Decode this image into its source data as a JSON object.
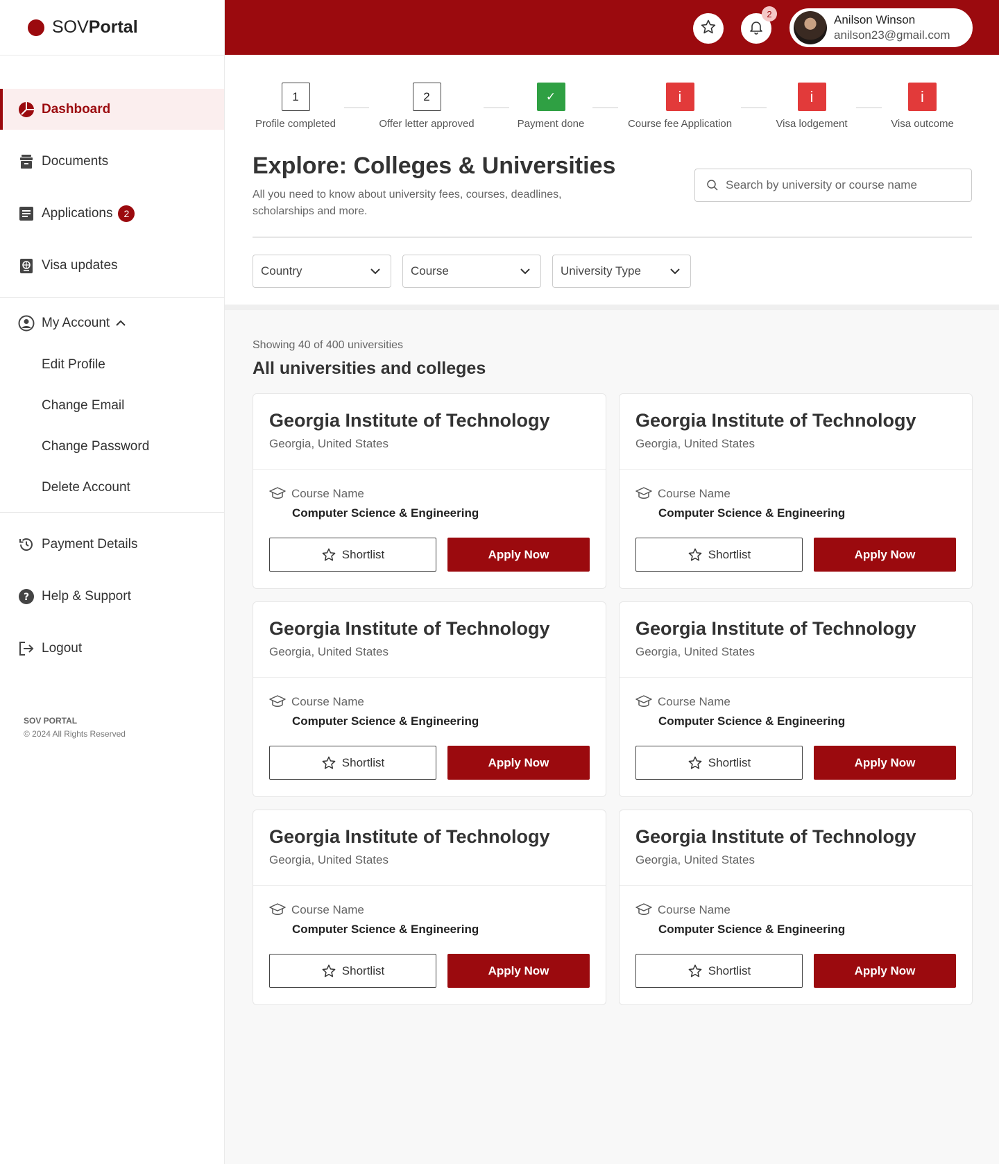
{
  "brand": {
    "prefix": "SOV",
    "suffix": "Portal",
    "color": "#9b0a0e"
  },
  "sidebar": {
    "main_items": [
      {
        "label": "Dashboard",
        "icon": "pie-chart-icon",
        "active": true
      },
      {
        "label": "Documents",
        "icon": "archive-icon"
      },
      {
        "label": "Applications",
        "icon": "list-icon",
        "badge": "2"
      },
      {
        "label": "Visa updates",
        "icon": "passport-icon"
      }
    ],
    "account": {
      "label": "My Account",
      "icon": "user-circle-icon",
      "sub_items": [
        "Edit Profile",
        "Change Email",
        "Change Password",
        "Delete Account"
      ]
    },
    "bottom_items": [
      {
        "label": "Payment Details",
        "icon": "history-icon"
      },
      {
        "label": "Help & Support",
        "icon": "help-icon"
      },
      {
        "label": "Logout",
        "icon": "logout-icon"
      }
    ],
    "footer": {
      "brand": "SOV PORTAL",
      "copyright": "© 2024 All Rights Reserved"
    }
  },
  "topbar": {
    "notifications_count": "2",
    "user": {
      "name": "Anilson Winson",
      "email": "anilson23@gmail.com"
    }
  },
  "steps": [
    {
      "label": "Profile completed",
      "value": "1",
      "status": "pending"
    },
    {
      "label": "Offer letter approved",
      "value": "2",
      "status": "pending"
    },
    {
      "label": "Payment done",
      "value": "✓",
      "status": "done"
    },
    {
      "label": "Course fee Application",
      "value": "i",
      "status": "alert"
    },
    {
      "label": "Visa lodgement",
      "value": "i",
      "status": "alert"
    },
    {
      "label": "Visa outcome",
      "value": "i",
      "status": "alert"
    }
  ],
  "explore": {
    "title": "Explore: Colleges & Universities",
    "subtitle": "All you need to know about university fees, courses, deadlines, scholarships and more.",
    "search_placeholder": "Search by university or course name"
  },
  "filters": [
    "Country",
    "Course",
    "University Type"
  ],
  "listing": {
    "showing": "Showing 40 of 400 universities",
    "title": "All universities and colleges",
    "course_label": "Course Name",
    "shortlist_label": "Shortlist",
    "apply_label": "Apply Now",
    "cards": [
      {
        "name": "Georgia Institute of Technology",
        "location": "Georgia, United States",
        "course": "Computer Science & Engineering"
      },
      {
        "name": "Georgia Institute of Technology",
        "location": "Georgia, United States",
        "course": "Computer Science & Engineering"
      },
      {
        "name": "Georgia Institute of Technology",
        "location": "Georgia, United States",
        "course": "Computer Science & Engineering"
      },
      {
        "name": "Georgia Institute of Technology",
        "location": "Georgia, United States",
        "course": "Computer Science & Engineering"
      },
      {
        "name": "Georgia Institute of Technology",
        "location": "Georgia, United States",
        "course": "Computer Science & Engineering"
      },
      {
        "name": "Georgia Institute of Technology",
        "location": "Georgia, United States",
        "course": "Computer Science & Engineering"
      }
    ]
  }
}
